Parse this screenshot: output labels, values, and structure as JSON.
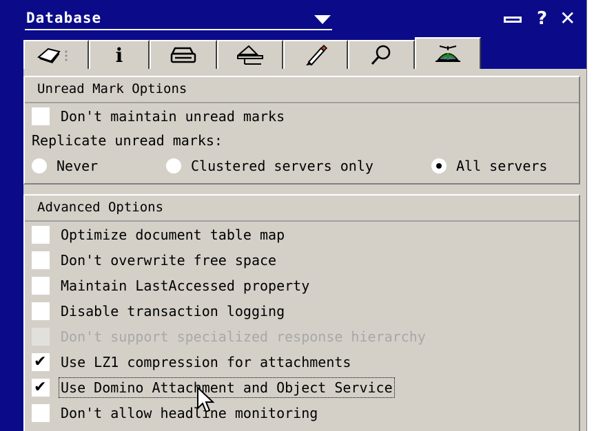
{
  "window": {
    "title": "Database",
    "help_label": "?",
    "close_label": "✕"
  },
  "tabs": [
    {
      "icon": "eraser-icon"
    },
    {
      "icon": "info-icon",
      "label": "i"
    },
    {
      "icon": "printer-icon"
    },
    {
      "icon": "inbox-icon"
    },
    {
      "icon": "pen-icon"
    },
    {
      "icon": "search-icon"
    },
    {
      "icon": "propeller-hat-icon",
      "active": true
    }
  ],
  "unread": {
    "title": "Unread Mark Options",
    "dont_maintain": {
      "label": "Don't maintain unread marks",
      "checked": false
    },
    "replicate_label": "Replicate unread marks:",
    "radios": [
      {
        "label": "Never",
        "selected": false
      },
      {
        "label": "Clustered servers only",
        "selected": false
      },
      {
        "label": "All servers",
        "selected": true
      }
    ]
  },
  "advanced": {
    "title": "Advanced Options",
    "items": [
      {
        "label": "Optimize document table map",
        "checked": false,
        "enabled": true
      },
      {
        "label": "Don't overwrite free space",
        "checked": false,
        "enabled": true
      },
      {
        "label": "Maintain LastAccessed property",
        "checked": false,
        "enabled": true
      },
      {
        "label": "Disable transaction logging",
        "checked": false,
        "enabled": true
      },
      {
        "label": "Don't support specialized response hierarchy",
        "checked": false,
        "enabled": false
      },
      {
        "label": "Use LZ1 compression for attachments",
        "checked": true,
        "enabled": true
      },
      {
        "label": "Use Domino Attachment and Object Service",
        "checked": true,
        "enabled": true,
        "focused": true
      },
      {
        "label": "Don't allow headline monitoring",
        "checked": false,
        "enabled": true
      }
    ]
  },
  "check_glyph": "✔",
  "colors": {
    "title_bar": "#0b0b8a",
    "panel": "#d4d0c8"
  }
}
